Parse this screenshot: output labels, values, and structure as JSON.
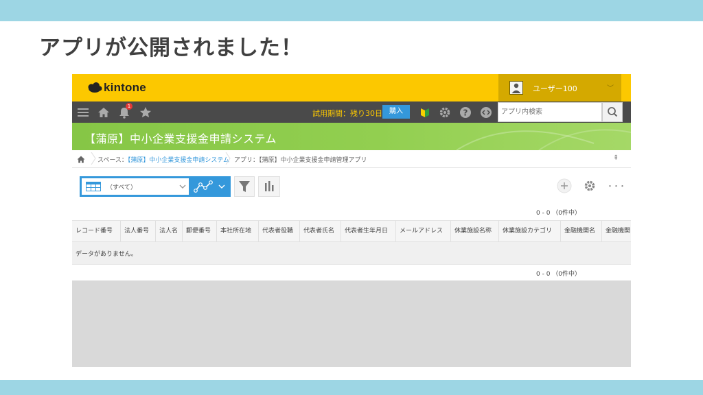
{
  "slide": {
    "title": "アプリが公開されました！",
    "band_color": "#9dd6e4"
  },
  "header": {
    "logo_text": "kintone",
    "user_name": "ユーザー100",
    "user_caret": "﹀",
    "accent": "#fcc800"
  },
  "toolbar": {
    "icons": [
      "menu-icon",
      "home-icon",
      "bell-icon",
      "star-icon",
      "beginner-mark-icon",
      "gear-icon",
      "help-icon",
      "code-icon",
      "search-icon"
    ],
    "notification_count": "1",
    "trial_text": "試用期間：残り30日",
    "buy_label": "購入",
    "search_placeholder": "アプリ内検索"
  },
  "app": {
    "title": "【蒲原】中小企業支援金申請システム"
  },
  "breadcrumb": {
    "space_prefix": "スペース：",
    "space_name": "【蒲原】中小企業支援金申請システム",
    "app_prefix": "アプリ：",
    "app_name": "【蒲原】中小企業支援金申請管理アプリ",
    "pin": "⇞"
  },
  "view": {
    "selected": "（すべて）",
    "record_count": "0 - 0 （0件中）",
    "more": "・・・"
  },
  "table": {
    "columns": [
      "レコード番号",
      "法人番号",
      "法人名",
      "郵便番号",
      "本社所在地",
      "代表者役職",
      "代表者氏名",
      "代表者生年月日",
      "メールアドレス",
      "休業施設名称",
      "休業施設カテゴリ",
      "金融機関名",
      "金融機関"
    ],
    "empty_message": "データがありません。"
  },
  "colors": {
    "primary_blue": "#3498db",
    "toolbar_bg": "#4a4a4a",
    "app_band": "#8cc84b",
    "badge_red": "#e53935"
  }
}
